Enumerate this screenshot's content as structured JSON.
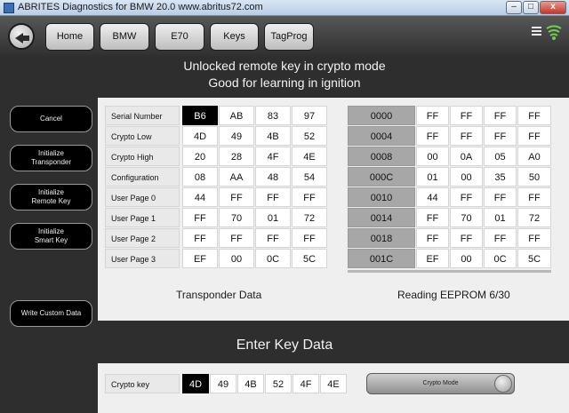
{
  "window": {
    "title": "ABRITES Diagnostics for BMW 20.0   www.abritus72.com",
    "minimize": "–",
    "maximize": "□",
    "close": "x"
  },
  "toolbar": {
    "back_icon": "back-arrow-icon",
    "nav": [
      "Home",
      "BMW",
      "E70",
      "Keys",
      "TagProg"
    ],
    "menu_icon": "hamburger-menu-icon",
    "signal_icon": "signal-strength-icon"
  },
  "status": {
    "line1": "Unlocked remote key in crypto mode",
    "line2": "Good for learning in ignition"
  },
  "sidebar": {
    "cancel": "Cancel",
    "init_transponder": [
      "Initialize",
      "Transponder"
    ],
    "init_remote_key": [
      "Initialize",
      "Remote Key"
    ],
    "init_smart_key": [
      "Initialize",
      "Smart Key"
    ],
    "write_custom": "Write Custom Data"
  },
  "transponder": {
    "caption": "Transponder Data",
    "rows": [
      {
        "label": "Serial Number",
        "bytes": [
          "B6",
          "AB",
          "83",
          "97"
        ]
      },
      {
        "label": "Crypto Low",
        "bytes": [
          "4D",
          "49",
          "4B",
          "52"
        ]
      },
      {
        "label": "Crypto High",
        "bytes": [
          "20",
          "28",
          "4F",
          "4E"
        ]
      },
      {
        "label": "Configuration",
        "bytes": [
          "08",
          "AA",
          "48",
          "54"
        ]
      },
      {
        "label": "User Page 0",
        "bytes": [
          "44",
          "FF",
          "FF",
          "FF"
        ]
      },
      {
        "label": "User Page 1",
        "bytes": [
          "FF",
          "70",
          "01",
          "72"
        ]
      },
      {
        "label": "User Page 2",
        "bytes": [
          "FF",
          "FF",
          "FF",
          "FF"
        ]
      },
      {
        "label": "User Page 3",
        "bytes": [
          "EF",
          "00",
          "0C",
          "5C"
        ]
      }
    ]
  },
  "eeprom": {
    "caption": "Reading EEPROM 6/30",
    "rows": [
      {
        "addr": "0000",
        "bytes": [
          "FF",
          "FF",
          "FF",
          "FF"
        ]
      },
      {
        "addr": "0004",
        "bytes": [
          "FF",
          "FF",
          "FF",
          "FF"
        ]
      },
      {
        "addr": "0008",
        "bytes": [
          "00",
          "0A",
          "05",
          "A0"
        ]
      },
      {
        "addr": "000C",
        "bytes": [
          "01",
          "00",
          "35",
          "50"
        ]
      },
      {
        "addr": "0010",
        "bytes": [
          "44",
          "FF",
          "FF",
          "FF"
        ]
      },
      {
        "addr": "0014",
        "bytes": [
          "FF",
          "70",
          "01",
          "72"
        ]
      },
      {
        "addr": "0018",
        "bytes": [
          "FF",
          "FF",
          "FF",
          "FF"
        ]
      },
      {
        "addr": "001C",
        "bytes": [
          "EF",
          "00",
          "0C",
          "5C"
        ]
      }
    ]
  },
  "enter_key": {
    "title": "Enter Key Data",
    "crypto_label": "Crypto key",
    "crypto_bytes": [
      "4D",
      "49",
      "4B",
      "52",
      "4F",
      "4E"
    ],
    "crypto_mode": "Crypto Mode"
  }
}
